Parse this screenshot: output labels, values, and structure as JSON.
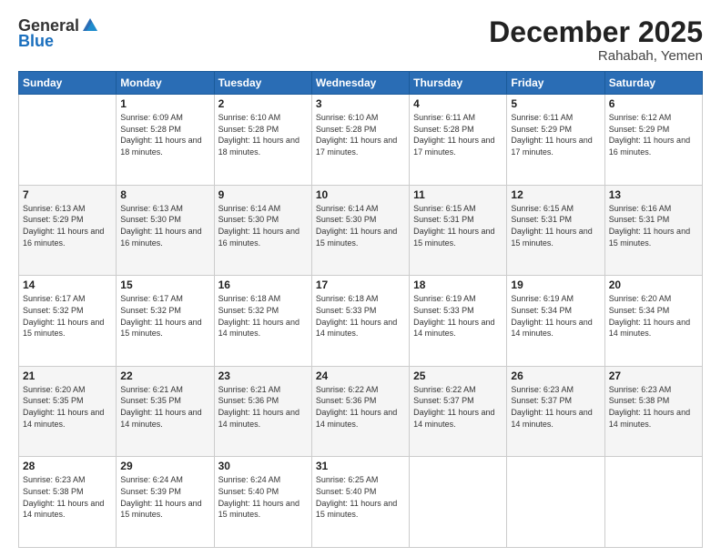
{
  "header": {
    "logo_general": "General",
    "logo_blue": "Blue",
    "month": "December 2025",
    "location": "Rahabah, Yemen"
  },
  "weekdays": [
    "Sunday",
    "Monday",
    "Tuesday",
    "Wednesday",
    "Thursday",
    "Friday",
    "Saturday"
  ],
  "weeks": [
    [
      {
        "day": "",
        "sunrise": "",
        "sunset": "",
        "daylight": ""
      },
      {
        "day": "1",
        "sunrise": "Sunrise: 6:09 AM",
        "sunset": "Sunset: 5:28 PM",
        "daylight": "Daylight: 11 hours and 18 minutes."
      },
      {
        "day": "2",
        "sunrise": "Sunrise: 6:10 AM",
        "sunset": "Sunset: 5:28 PM",
        "daylight": "Daylight: 11 hours and 18 minutes."
      },
      {
        "day": "3",
        "sunrise": "Sunrise: 6:10 AM",
        "sunset": "Sunset: 5:28 PM",
        "daylight": "Daylight: 11 hours and 17 minutes."
      },
      {
        "day": "4",
        "sunrise": "Sunrise: 6:11 AM",
        "sunset": "Sunset: 5:28 PM",
        "daylight": "Daylight: 11 hours and 17 minutes."
      },
      {
        "day": "5",
        "sunrise": "Sunrise: 6:11 AM",
        "sunset": "Sunset: 5:29 PM",
        "daylight": "Daylight: 11 hours and 17 minutes."
      },
      {
        "day": "6",
        "sunrise": "Sunrise: 6:12 AM",
        "sunset": "Sunset: 5:29 PM",
        "daylight": "Daylight: 11 hours and 16 minutes."
      }
    ],
    [
      {
        "day": "7",
        "sunrise": "Sunrise: 6:13 AM",
        "sunset": "Sunset: 5:29 PM",
        "daylight": "Daylight: 11 hours and 16 minutes."
      },
      {
        "day": "8",
        "sunrise": "Sunrise: 6:13 AM",
        "sunset": "Sunset: 5:30 PM",
        "daylight": "Daylight: 11 hours and 16 minutes."
      },
      {
        "day": "9",
        "sunrise": "Sunrise: 6:14 AM",
        "sunset": "Sunset: 5:30 PM",
        "daylight": "Daylight: 11 hours and 16 minutes."
      },
      {
        "day": "10",
        "sunrise": "Sunrise: 6:14 AM",
        "sunset": "Sunset: 5:30 PM",
        "daylight": "Daylight: 11 hours and 15 minutes."
      },
      {
        "day": "11",
        "sunrise": "Sunrise: 6:15 AM",
        "sunset": "Sunset: 5:31 PM",
        "daylight": "Daylight: 11 hours and 15 minutes."
      },
      {
        "day": "12",
        "sunrise": "Sunrise: 6:15 AM",
        "sunset": "Sunset: 5:31 PM",
        "daylight": "Daylight: 11 hours and 15 minutes."
      },
      {
        "day": "13",
        "sunrise": "Sunrise: 6:16 AM",
        "sunset": "Sunset: 5:31 PM",
        "daylight": "Daylight: 11 hours and 15 minutes."
      }
    ],
    [
      {
        "day": "14",
        "sunrise": "Sunrise: 6:17 AM",
        "sunset": "Sunset: 5:32 PM",
        "daylight": "Daylight: 11 hours and 15 minutes."
      },
      {
        "day": "15",
        "sunrise": "Sunrise: 6:17 AM",
        "sunset": "Sunset: 5:32 PM",
        "daylight": "Daylight: 11 hours and 15 minutes."
      },
      {
        "day": "16",
        "sunrise": "Sunrise: 6:18 AM",
        "sunset": "Sunset: 5:32 PM",
        "daylight": "Daylight: 11 hours and 14 minutes."
      },
      {
        "day": "17",
        "sunrise": "Sunrise: 6:18 AM",
        "sunset": "Sunset: 5:33 PM",
        "daylight": "Daylight: 11 hours and 14 minutes."
      },
      {
        "day": "18",
        "sunrise": "Sunrise: 6:19 AM",
        "sunset": "Sunset: 5:33 PM",
        "daylight": "Daylight: 11 hours and 14 minutes."
      },
      {
        "day": "19",
        "sunrise": "Sunrise: 6:19 AM",
        "sunset": "Sunset: 5:34 PM",
        "daylight": "Daylight: 11 hours and 14 minutes."
      },
      {
        "day": "20",
        "sunrise": "Sunrise: 6:20 AM",
        "sunset": "Sunset: 5:34 PM",
        "daylight": "Daylight: 11 hours and 14 minutes."
      }
    ],
    [
      {
        "day": "21",
        "sunrise": "Sunrise: 6:20 AM",
        "sunset": "Sunset: 5:35 PM",
        "daylight": "Daylight: 11 hours and 14 minutes."
      },
      {
        "day": "22",
        "sunrise": "Sunrise: 6:21 AM",
        "sunset": "Sunset: 5:35 PM",
        "daylight": "Daylight: 11 hours and 14 minutes."
      },
      {
        "day": "23",
        "sunrise": "Sunrise: 6:21 AM",
        "sunset": "Sunset: 5:36 PM",
        "daylight": "Daylight: 11 hours and 14 minutes."
      },
      {
        "day": "24",
        "sunrise": "Sunrise: 6:22 AM",
        "sunset": "Sunset: 5:36 PM",
        "daylight": "Daylight: 11 hours and 14 minutes."
      },
      {
        "day": "25",
        "sunrise": "Sunrise: 6:22 AM",
        "sunset": "Sunset: 5:37 PM",
        "daylight": "Daylight: 11 hours and 14 minutes."
      },
      {
        "day": "26",
        "sunrise": "Sunrise: 6:23 AM",
        "sunset": "Sunset: 5:37 PM",
        "daylight": "Daylight: 11 hours and 14 minutes."
      },
      {
        "day": "27",
        "sunrise": "Sunrise: 6:23 AM",
        "sunset": "Sunset: 5:38 PM",
        "daylight": "Daylight: 11 hours and 14 minutes."
      }
    ],
    [
      {
        "day": "28",
        "sunrise": "Sunrise: 6:23 AM",
        "sunset": "Sunset: 5:38 PM",
        "daylight": "Daylight: 11 hours and 14 minutes."
      },
      {
        "day": "29",
        "sunrise": "Sunrise: 6:24 AM",
        "sunset": "Sunset: 5:39 PM",
        "daylight": "Daylight: 11 hours and 15 minutes."
      },
      {
        "day": "30",
        "sunrise": "Sunrise: 6:24 AM",
        "sunset": "Sunset: 5:40 PM",
        "daylight": "Daylight: 11 hours and 15 minutes."
      },
      {
        "day": "31",
        "sunrise": "Sunrise: 6:25 AM",
        "sunset": "Sunset: 5:40 PM",
        "daylight": "Daylight: 11 hours and 15 minutes."
      },
      {
        "day": "",
        "sunrise": "",
        "sunset": "",
        "daylight": ""
      },
      {
        "day": "",
        "sunrise": "",
        "sunset": "",
        "daylight": ""
      },
      {
        "day": "",
        "sunrise": "",
        "sunset": "",
        "daylight": ""
      }
    ]
  ]
}
